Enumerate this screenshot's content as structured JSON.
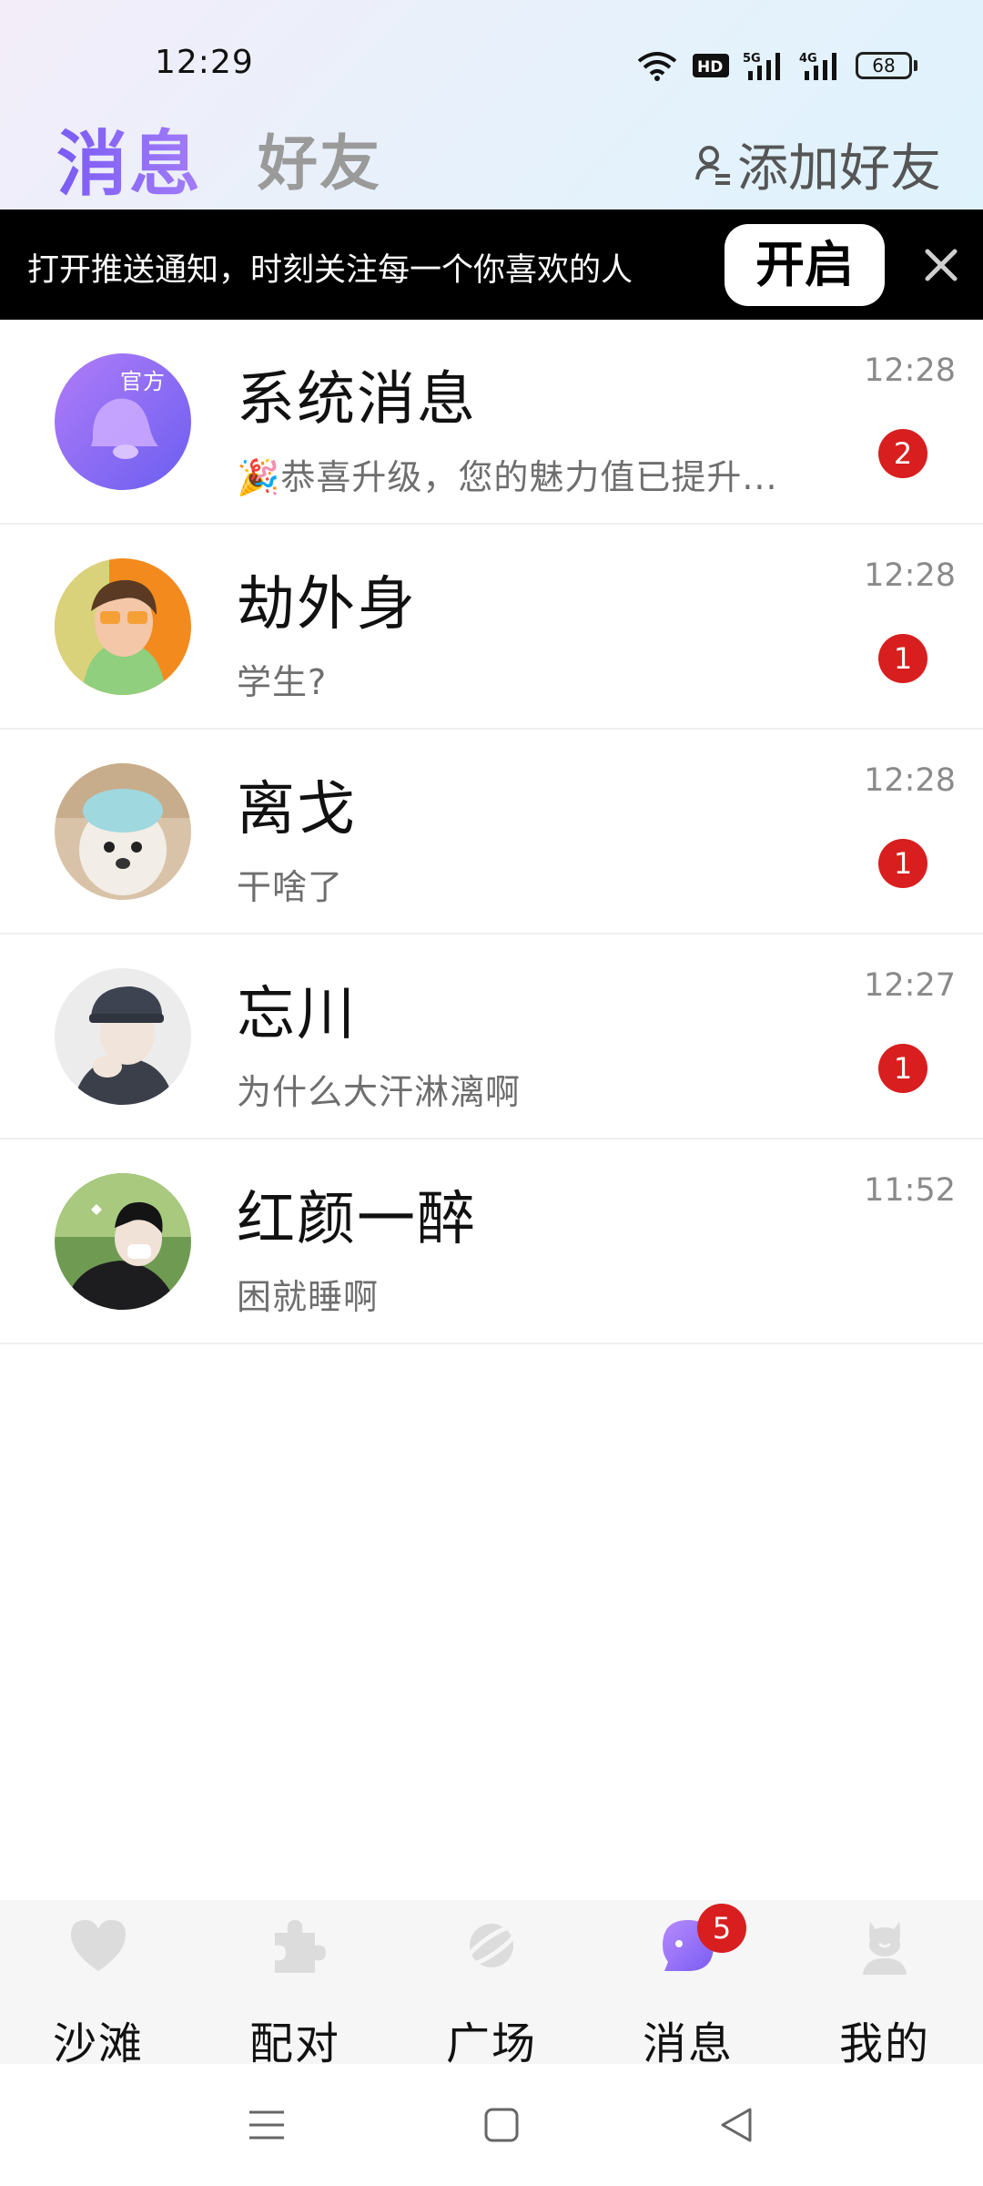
{
  "status_bar": {
    "time": "12:29",
    "battery": "68",
    "icons": [
      "wifi-icon",
      "hd-icon",
      "signal-5g-icon",
      "signal-4g-icon",
      "battery-icon"
    ]
  },
  "header": {
    "tab_active": "消息",
    "tab_inactive": "好友",
    "add_friend_label": "添加好友"
  },
  "notification_banner": {
    "text": "打开推送通知，时刻关注每一个你喜欢的人",
    "enable_button": "开启",
    "close_icon": "close-icon"
  },
  "chats": [
    {
      "name": "系统消息",
      "preview": "🎉恭喜升级，您的魅力值已提升...",
      "time": "12:28",
      "unread": "2",
      "tag": "官方",
      "avatar_icon": "bell-icon"
    },
    {
      "name": "劫外身",
      "preview": "学生?",
      "time": "12:28",
      "unread": "1"
    },
    {
      "name": "离戈",
      "preview": "干啥了",
      "time": "12:28",
      "unread": "1"
    },
    {
      "name": "忘川",
      "preview": "为什么大汗淋漓啊",
      "time": "12:27",
      "unread": "1"
    },
    {
      "name": "红颜一醉",
      "preview": "困就睡啊",
      "time": "11:52"
    }
  ],
  "bottom_nav": [
    {
      "label": "沙滩",
      "icon": "heart-icon"
    },
    {
      "label": "配对",
      "icon": "puzzle-icon"
    },
    {
      "label": "广场",
      "icon": "planet-icon"
    },
    {
      "label": "消息",
      "icon": "chat-bubble-icon",
      "badge": "5",
      "active": true
    },
    {
      "label": "我的",
      "icon": "person-icon"
    }
  ],
  "colors": {
    "accent": "#8a66f6",
    "badge": "#d81e1e",
    "banner_bg": "#000000",
    "inactive_text": "#9a9a9a"
  }
}
